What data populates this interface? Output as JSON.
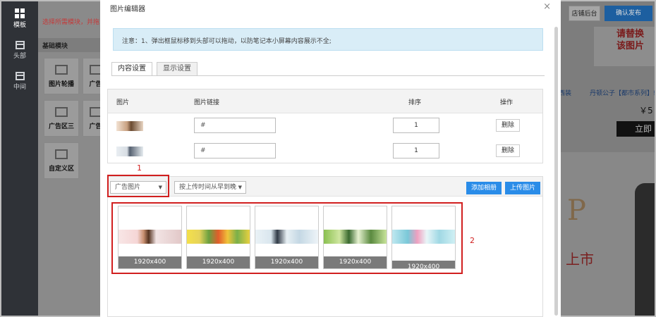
{
  "leftnav": {
    "items": [
      {
        "label": "模板",
        "icon": "grid-icon"
      },
      {
        "label": "头部",
        "icon": "header-icon"
      },
      {
        "label": "中间",
        "icon": "middle-icon"
      }
    ]
  },
  "modules": {
    "tip": "选择所需模块，并拖",
    "section": "基础模块",
    "tiles": [
      "图片轮播",
      "广告",
      "广告区三",
      "广告",
      "自定义区"
    ]
  },
  "page": {
    "shop_backend": "店铺后台",
    "confirm_publish": "确认发布",
    "promo_text_1": "请替换",
    "promo_text_2": "该图片",
    "product_name_1": "西装",
    "product_name_2": "丹顿公子【都市系列】!",
    "price": "￥5",
    "buy_label": "立即",
    "banner_letter": "P",
    "banner_red_text": "上市"
  },
  "dialog": {
    "title": "图片编辑器",
    "close": "×",
    "notice": "注意：1、弹出框鼠标移到头部可以拖动，以防笔记本小屏幕内容展示不全;",
    "tabs": [
      {
        "label": "内容设置",
        "active": true
      },
      {
        "label": "显示设置",
        "active": false
      }
    ],
    "table": {
      "headers": [
        "图片",
        "图片链接",
        "排序",
        "操作"
      ],
      "rows": [
        {
          "link": "#",
          "sort": "1",
          "action": "删除"
        },
        {
          "link": "#",
          "sort": "1",
          "action": "删除"
        }
      ]
    },
    "library": {
      "category_select": "广告图片",
      "order_select": "按上传时间从早到晚",
      "add_album": "添加相册",
      "upload": "上传图片",
      "images": [
        {
          "size": "1920x400"
        },
        {
          "size": "1920x400"
        },
        {
          "size": "1920x400"
        },
        {
          "size": "1920x400"
        },
        {
          "size": "1920x400"
        }
      ]
    }
  },
  "annotations": {
    "label1": "1",
    "label2": "2"
  }
}
